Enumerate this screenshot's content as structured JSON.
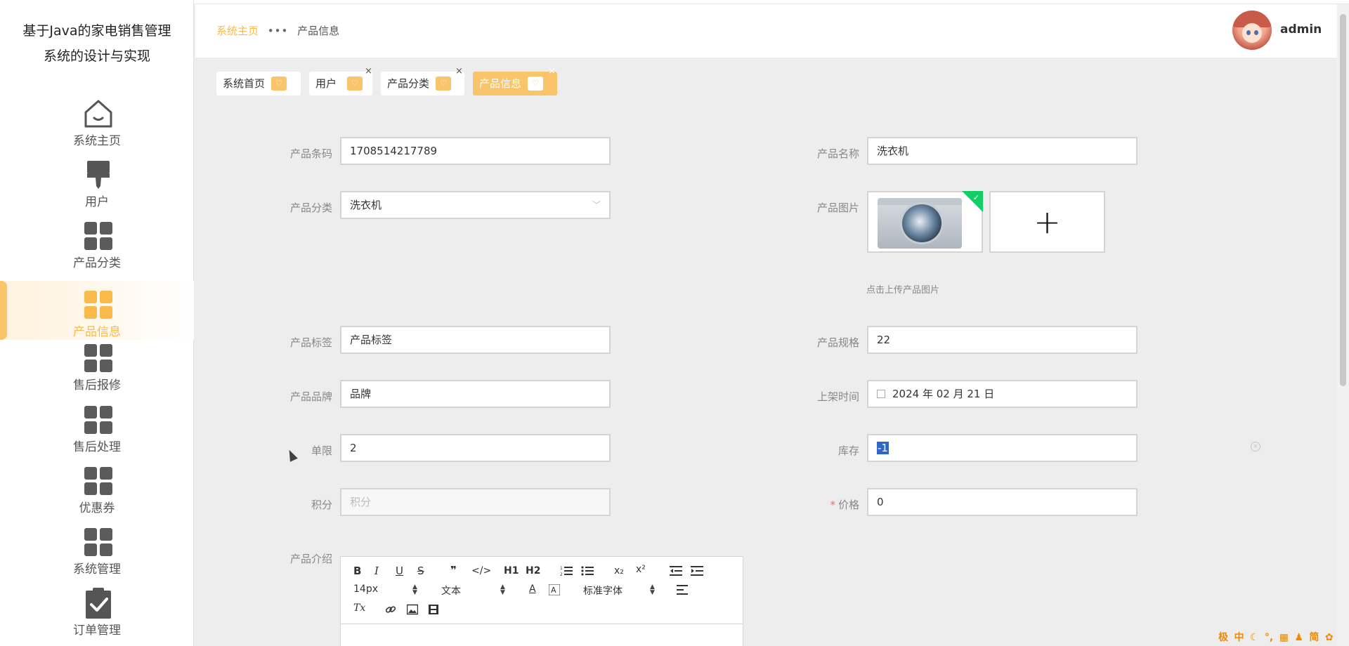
{
  "app": {
    "title_line1": "基于Java的家电销售管理",
    "title_line2": "系统的设计与实现"
  },
  "sidebar": {
    "items": [
      {
        "label": "系统主页",
        "icon": "home-icon"
      },
      {
        "label": "用户",
        "icon": "brush-icon"
      },
      {
        "label": "产品分类",
        "icon": "grid-icon"
      },
      {
        "label": "产品信息",
        "icon": "grid-icon",
        "active": true
      },
      {
        "label": "售后报修",
        "icon": "grid-icon"
      },
      {
        "label": "售后处理",
        "icon": "grid-icon"
      },
      {
        "label": "优惠券",
        "icon": "grid-icon"
      },
      {
        "label": "系统管理",
        "icon": "grid-icon"
      },
      {
        "label": "订单管理",
        "icon": "clipboard-check-icon"
      }
    ]
  },
  "header": {
    "breadcrumb_home": "系统主页",
    "breadcrumb_sep": "•••",
    "breadcrumb_current": "产品信息",
    "username": "admin"
  },
  "tags": [
    {
      "label": "系统首页",
      "closable": false
    },
    {
      "label": "用户",
      "closable": true,
      "close": "×"
    },
    {
      "label": "产品分类",
      "closable": true,
      "close": "×"
    },
    {
      "label": "产品信息",
      "closable": true,
      "active": true,
      "close": "×"
    }
  ],
  "form": {
    "barcode": {
      "label": "产品条码",
      "value": "1708514217789"
    },
    "name": {
      "label": "产品名称",
      "value": "洗衣机"
    },
    "category": {
      "label": "产品分类",
      "value": "洗衣机"
    },
    "image": {
      "label": "产品图片",
      "hint": "点击上传产品图片",
      "add_symbol": "+"
    },
    "tag": {
      "label": "产品标签",
      "value": "产品标签"
    },
    "spec": {
      "label": "产品规格",
      "value": "22"
    },
    "brand": {
      "label": "产品品牌",
      "value": "品牌"
    },
    "shelf_time": {
      "label": "上架时间",
      "value": "2024 年 02 月 21 日"
    },
    "limit": {
      "label": "单限",
      "value": "2"
    },
    "stock": {
      "label": "库存",
      "value": "-1"
    },
    "points": {
      "label": "积分",
      "placeholder": "积分"
    },
    "price": {
      "label": "价格",
      "required_mark": "*",
      "value": "0"
    },
    "intro": {
      "label": "产品介绍"
    }
  },
  "editor": {
    "font_size": "14px",
    "block_type": "文本",
    "font_family": "标准字体",
    "buttons": [
      "B",
      "I",
      "U",
      "S",
      "❞",
      "</>",
      "H1",
      "H2",
      "ol",
      "ul",
      "x₂",
      "x²",
      "outdent",
      "indent",
      "A",
      "bg",
      "align",
      "Tx",
      "link",
      "image",
      "video"
    ]
  },
  "tray": [
    "极",
    "中",
    "☾",
    "°,",
    "▦",
    "♟",
    "简",
    "✿"
  ],
  "colors": {
    "accent": "#f9c46a",
    "accent_text": "#f9b94b",
    "sidebar_bg": "#ffffff",
    "content_bg": "#ededed",
    "required": "#f56c6c",
    "upload_success": "#13ce66"
  }
}
